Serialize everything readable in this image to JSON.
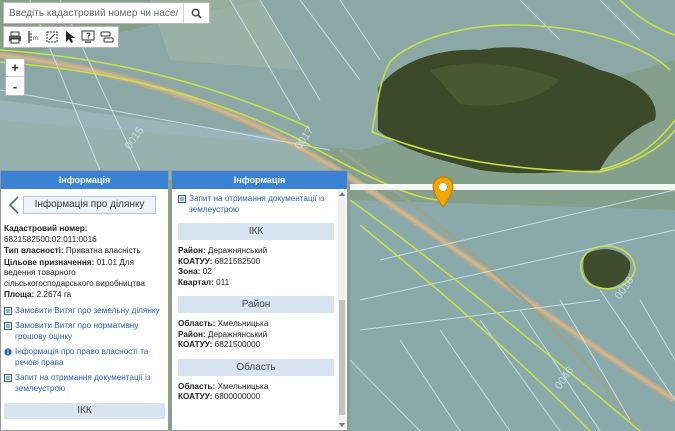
{
  "search": {
    "placeholder": "Введіть кадастровий номер чи населений"
  },
  "toolbar": {
    "buttons": [
      "print-icon",
      "ruler-icon",
      "area-measure-icon",
      "cursor-icon",
      "help-icon",
      "layers-icon"
    ]
  },
  "zoom": {
    "in_label": "+",
    "out_label": "-"
  },
  "left_panel": {
    "header": "Інформація",
    "back_title": "Інформація про ділянку",
    "cad_number_label": "Кадастровий номер:",
    "cad_number": "6821582500:02:011:0016",
    "ownership_label": "Тип власності:",
    "ownership": "Приватна власність",
    "purpose_label": "Цільове призначення:",
    "purpose": "01.01  Для ведення товарного сільськогосподарського виробництва",
    "area_label": "Площа:",
    "area": "2.2674 га",
    "links": [
      "Замовити Витяг про земельну ділянку",
      "Замовити Витяг про нормативну грошову оцінку",
      "Інформація про право власності та речові права",
      "Запит на отримання документації із землеустрою"
    ],
    "section_ikk": "ІКК"
  },
  "right_panel": {
    "header": "Інформація",
    "top_link": "Запит на отримання документації із землеустрою",
    "ikk": {
      "title": "ІКК",
      "district_label": "Район:",
      "district": "Деражнянський",
      "koatuu_label": "КОАТУУ:",
      "koatuu": "6821582500",
      "zone_label": "Зона:",
      "zone": "02",
      "quarter_label": "Квартал:",
      "quarter": "011"
    },
    "rayon": {
      "title": "Район",
      "region_label": "Область:",
      "region": "Хмельницька",
      "district_label": "Район:",
      "district": "Деражнянський",
      "koatuu_label": "КОАТУУ:",
      "koatuu": "6821500000"
    },
    "oblast": {
      "title": "Область",
      "region_label": "Область:",
      "region": "Хмельницька",
      "koatuu_label": "КОАТУУ:",
      "koatuu": "6800000000"
    }
  },
  "colors": {
    "panel_header": "#3a82d4",
    "section_bg": "#d8e4f0",
    "link": "#2a5fb0",
    "parcel_outline": "#c8e04a",
    "pin": "#f0a500"
  }
}
